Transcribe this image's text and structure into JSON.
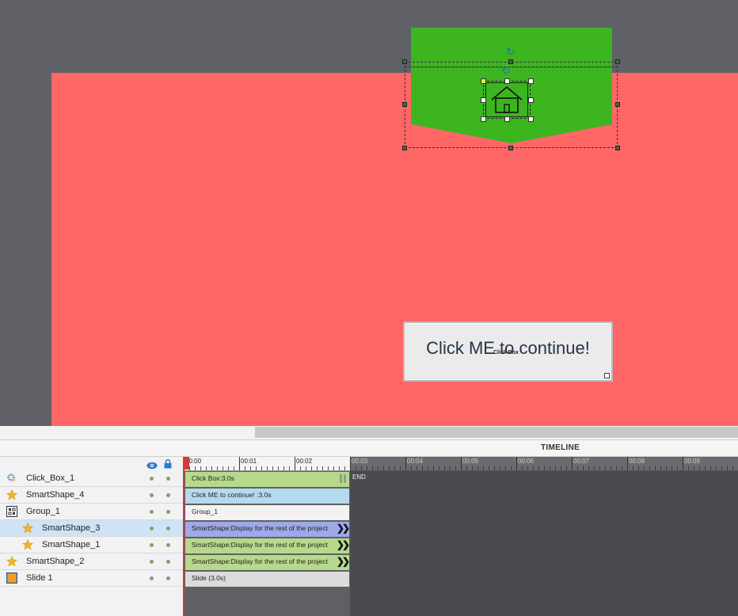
{
  "stage": {
    "click_button_label": "Click ME to continue!",
    "click_box_overlay": "Click Box"
  },
  "timeline": {
    "title": "TIMELINE",
    "ruler_ticks": [
      "00:00",
      "00:01",
      "00:02",
      "00:03",
      "00:04",
      "00:05",
      "00:06",
      "00:07",
      "00:08",
      "00:09"
    ],
    "end_label": "END"
  },
  "layers": [
    {
      "name": "Click_Box_1",
      "icon": "click-box-icon",
      "indent": false,
      "selected": false
    },
    {
      "name": "SmartShape_4",
      "icon": "star-icon",
      "indent": false,
      "selected": false
    },
    {
      "name": "Group_1",
      "icon": "group-icon",
      "indent": false,
      "selected": false
    },
    {
      "name": "SmartShape_3",
      "icon": "star-icon",
      "indent": true,
      "selected": true
    },
    {
      "name": "SmartShape_1",
      "icon": "star-icon",
      "indent": true,
      "selected": false
    },
    {
      "name": "SmartShape_2",
      "icon": "star-icon",
      "indent": false,
      "selected": false
    },
    {
      "name": "Slide 1",
      "icon": "slide-icon",
      "indent": false,
      "selected": false
    }
  ],
  "tracks": [
    {
      "label": "Click Box:3.0s",
      "color": "green"
    },
    {
      "label": "Click ME to continue!  :3.0s",
      "color": "blue"
    },
    {
      "label": "Group_1",
      "color": "white"
    },
    {
      "label": "SmartShape:Display for the rest of the project",
      "color": "purple"
    },
    {
      "label": "SmartShape:Display for the rest of the project",
      "color": "green"
    },
    {
      "label": "SmartShape:Display for the rest of the project",
      "color": "green"
    },
    {
      "label": "Slide (3.0s)",
      "color": "gray"
    }
  ],
  "colors": {
    "workspace": "#5f6167",
    "slide_background": "#ff6767",
    "banner_green": "#3cb521",
    "selected_layer": "#cfe3f7",
    "playhead": "#d13b3b"
  }
}
